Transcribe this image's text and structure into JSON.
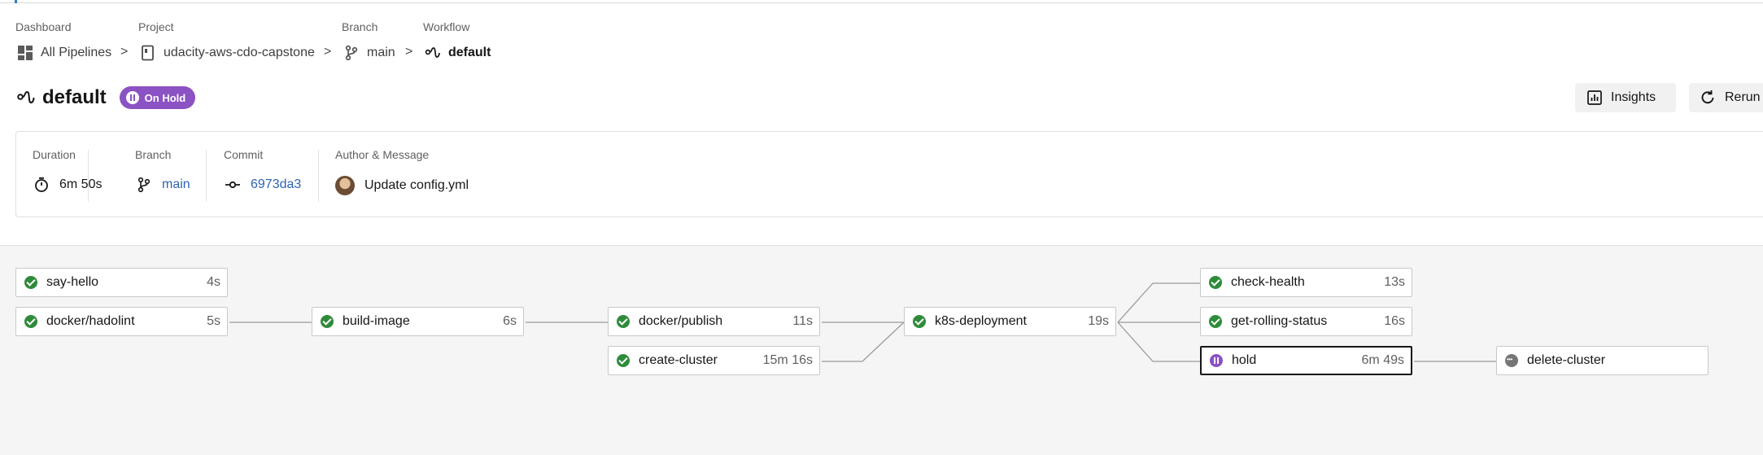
{
  "breadcrumbs": {
    "labels": {
      "dashboard": "Dashboard",
      "project": "Project",
      "branch": "Branch",
      "workflow": "Workflow"
    },
    "dashboard": "All Pipelines",
    "project": "udacity-aws-cdo-capstone",
    "branch": "main",
    "workflow": "default",
    "separator": ">"
  },
  "header": {
    "title": "default",
    "status": "On Hold",
    "status_color": "#8b52c3",
    "insights_label": "Insights",
    "rerun_label": "Rerun"
  },
  "summary": {
    "duration_label": "Duration",
    "duration": "6m 50s",
    "branch_label": "Branch",
    "branch": "main",
    "commit_label": "Commit",
    "commit": "6973da3",
    "author_label": "Author & Message",
    "message": "Update config.yml"
  },
  "jobs": [
    {
      "name": "say-hello",
      "duration": "4s",
      "status": "success"
    },
    {
      "name": "docker/hadolint",
      "duration": "5s",
      "status": "success"
    },
    {
      "name": "build-image",
      "duration": "6s",
      "status": "success"
    },
    {
      "name": "docker/publish",
      "duration": "11s",
      "status": "success"
    },
    {
      "name": "create-cluster",
      "duration": "15m 16s",
      "status": "success"
    },
    {
      "name": "k8s-deployment",
      "duration": "19s",
      "status": "success"
    },
    {
      "name": "check-health",
      "duration": "13s",
      "status": "success"
    },
    {
      "name": "get-rolling-status",
      "duration": "16s",
      "status": "success"
    },
    {
      "name": "hold",
      "duration": "6m 49s",
      "status": "on-hold"
    },
    {
      "name": "delete-cluster",
      "duration": "",
      "status": "blocked"
    }
  ],
  "colors": {
    "success": "#2e8b3a",
    "on_hold": "#8b52c3",
    "blocked": "#767676",
    "link": "#2f63b4"
  }
}
